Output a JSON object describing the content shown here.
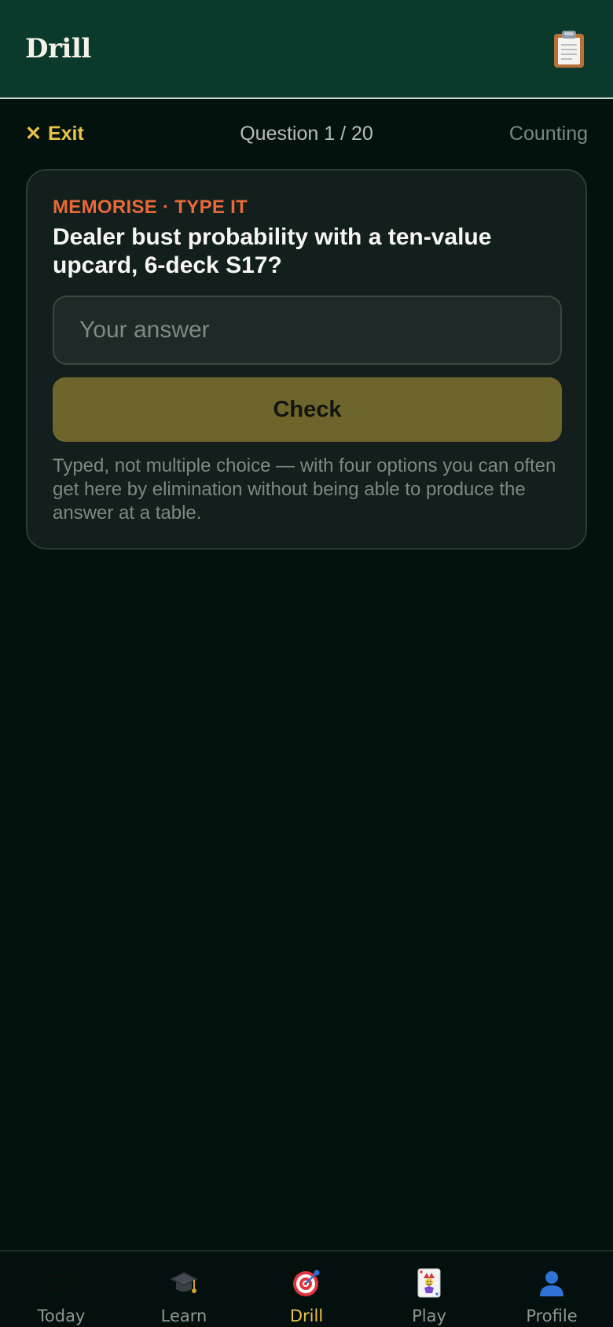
{
  "header": {
    "title": "Drill",
    "action_icon": "clipboard-icon"
  },
  "subbar": {
    "exit_icon": "close-icon",
    "exit_label": "Exit",
    "question_counter": "Question 1 / 20",
    "mode_label": "Counting"
  },
  "card": {
    "tag": "MEMORISE · TYPE IT",
    "question": "Dealer bust probability with a ten-value upcard, 6-deck S17?",
    "answer_value": "",
    "answer_placeholder": "Your answer",
    "check_label": "Check",
    "hint": "Typed, not multiple choice — with four options you can often get here by elimination without being able to produce the answer at a table."
  },
  "nav": {
    "items": [
      {
        "label": "Today",
        "icon": "menu-icon",
        "active": false
      },
      {
        "label": "Learn",
        "icon": "graduation-cap-icon",
        "active": false
      },
      {
        "label": "Drill",
        "icon": "target-icon",
        "active": true
      },
      {
        "label": "Play",
        "icon": "joker-card-icon",
        "active": false
      },
      {
        "label": "Profile",
        "icon": "user-icon",
        "active": false
      }
    ]
  },
  "colors": {
    "header_bg": "#0b3a2d",
    "page_bg": "#04120e",
    "accent": "#e9c348",
    "tag": "#e8693a",
    "button_bg": "#6e652c"
  }
}
